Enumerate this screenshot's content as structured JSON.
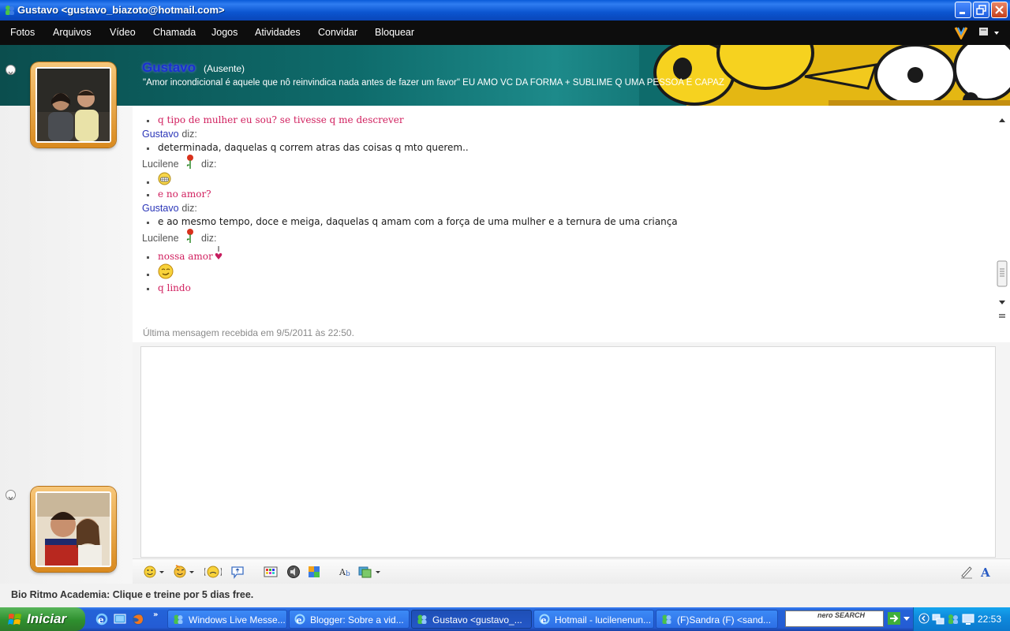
{
  "window": {
    "title": "Gustavo <gustavo_biazoto@hotmail.com>"
  },
  "menu": [
    "Fotos",
    "Arquivos",
    "Vídeo",
    "Chamada",
    "Jogos",
    "Atividades",
    "Convidar",
    "Bloquear"
  ],
  "contact": {
    "name": "Gustavo",
    "status": "(Ausente)",
    "personal_message": "\"Amor incondicional é aquele que nô reinvindica nada antes de fazer um favor\" EU AMO VC DA FORMA + SUBLIME Q UMA PESSOA  E CAPAZ"
  },
  "chat": {
    "lines": [
      {
        "kind": "msg",
        "who": "l",
        "text": "q tipo de mulher eu sou? se tivesse q me descrever"
      },
      {
        "kind": "sender",
        "who": "g",
        "name": "Gustavo",
        "says": "diz:"
      },
      {
        "kind": "msg",
        "who": "g",
        "text": "determinada, daquelas q correm atras das coisas q mto querem.."
      },
      {
        "kind": "sender",
        "who": "l",
        "name": "Lucilene",
        "says": "diz:"
      },
      {
        "kind": "emoticon",
        "icon": "grin-emoticon"
      },
      {
        "kind": "msg",
        "who": "l",
        "text": "e no amor?"
      },
      {
        "kind": "sender",
        "who": "g",
        "name": "Gustavo",
        "says": "diz:"
      },
      {
        "kind": "msg",
        "who": "g",
        "text": "e ao mesmo tempo, doce e meiga, daquelas q amam com a força de uma mulher e a ternura de uma criança"
      },
      {
        "kind": "sender",
        "who": "l",
        "name": "Lucilene",
        "says": "diz:"
      },
      {
        "kind": "msg",
        "who": "l",
        "text": "nossa amor",
        "icon": "heart-icon"
      },
      {
        "kind": "emoticon",
        "icon": "smile-emoticon"
      },
      {
        "kind": "msg",
        "who": "l",
        "text": "q lindo"
      }
    ],
    "last_message": "Última mensagem recebida em 9/5/2011 às 22:50."
  },
  "toolbar": [
    "emoticon-icon",
    "wink-icon",
    "nudge-icon",
    "voice-clip-icon",
    "background-icon",
    "sound-icon",
    "game-icon",
    "font-icon",
    "image-icon",
    "handwriting-icon",
    "text-icon"
  ],
  "ad": {
    "text": "Bio Ritmo Academia: Clique e treine por 5 dias free."
  },
  "taskbar": {
    "start_label": "Iniciar",
    "tasks": [
      {
        "label": "Windows Live Messe...",
        "icon": "messenger-icon"
      },
      {
        "label": "Blogger: Sobre a vid...",
        "icon": "ie-icon"
      },
      {
        "label": "Gustavo <gustavo_...",
        "icon": "messenger-icon"
      },
      {
        "label": "Hotmail - lucilenenun...",
        "icon": "ie-icon"
      },
      {
        "label": "(F)Sandra (F) <sand...",
        "icon": "messenger-icon"
      }
    ],
    "search_brand": "nero SEARCH",
    "clock": "22:53"
  }
}
